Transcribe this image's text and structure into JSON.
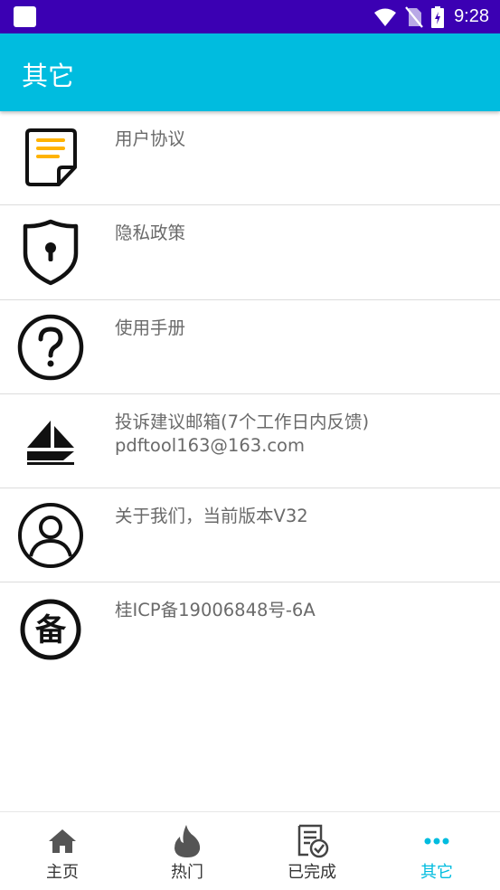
{
  "status_bar": {
    "time": "9:28"
  },
  "app_bar": {
    "title": "其它"
  },
  "items": [
    {
      "label": "用户协议",
      "icon": "document-icon"
    },
    {
      "label": "隐私政策",
      "icon": "shield-lock-icon"
    },
    {
      "label": "使用手册",
      "icon": "question-icon"
    },
    {
      "label": "投诉建议邮箱(7个工作日内反馈)",
      "sub": "pdftool163@163.com",
      "icon": "send-icon"
    },
    {
      "label": "关于我们，当前版本V32",
      "icon": "user-icon"
    },
    {
      "label": "桂ICP备19006848号-6A",
      "icon": "bei-icon",
      "glyph": "备"
    }
  ],
  "nav": [
    {
      "label": "主页",
      "icon": "home-icon"
    },
    {
      "label": "热门",
      "icon": "flame-icon"
    },
    {
      "label": "已完成",
      "icon": "checklist-icon"
    },
    {
      "label": "其它",
      "icon": "more-icon"
    }
  ],
  "colors": {
    "status_bar": "#3b00b3",
    "app_bar": "#00bcdf",
    "accent": "#00bcdf"
  }
}
